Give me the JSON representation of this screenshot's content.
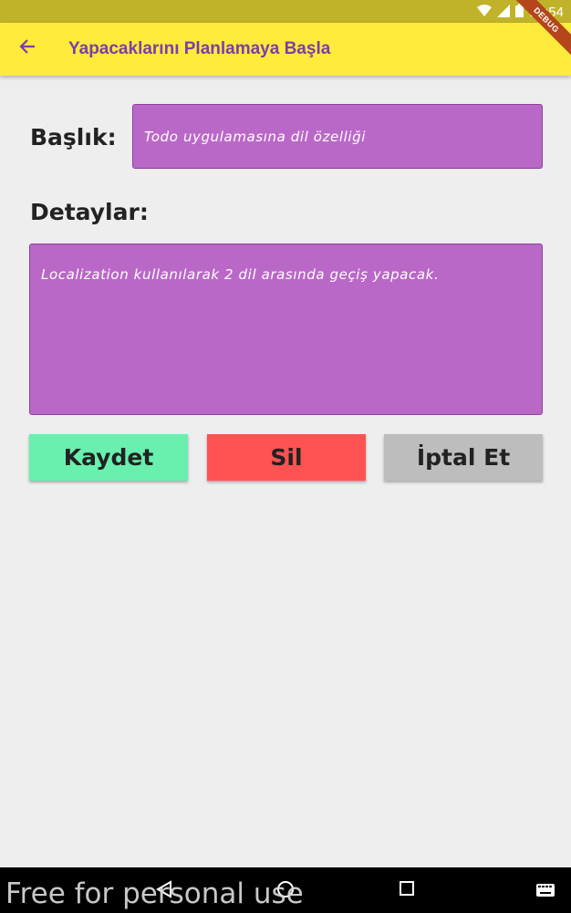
{
  "status_bar": {
    "time": "12:54",
    "icons": [
      "wifi-icon",
      "signal-icon",
      "battery-icon"
    ],
    "debug_label": "DEBUG",
    "color": "#c0b32a"
  },
  "app_bar": {
    "title": "Yapacaklarını Planlamaya Başla",
    "back_icon": "arrow-back-icon",
    "background": "#ffeb3b",
    "title_color": "#7b3fa6"
  },
  "form": {
    "title_label": "Başlık:",
    "title_value": "Todo uygulamasına dil özelliği",
    "details_label": "Detaylar:",
    "details_value": "Localization kullanılarak 2 dil arasında geçiş yapacak.",
    "field_color": "#ba68c8"
  },
  "buttons": {
    "save": {
      "label": "Kaydet",
      "color": "#69f0ae"
    },
    "delete": {
      "label": "Sil",
      "color": "#ff5252"
    },
    "cancel": {
      "label": "İptal Et",
      "color": "#bdbdbd"
    }
  },
  "nav_bar": {
    "icons": [
      "back-triangle-icon",
      "home-circle-icon",
      "recents-square-icon",
      "keyboard-icon"
    ]
  },
  "watermark": "Free for personal use"
}
